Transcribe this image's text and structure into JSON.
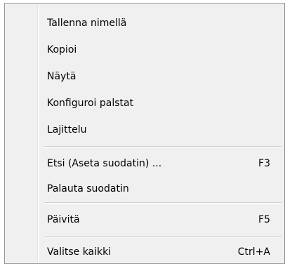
{
  "context_menu": {
    "items": [
      {
        "label": "Tallenna nimellä",
        "shortcut": ""
      },
      {
        "label": "Kopioi",
        "shortcut": ""
      },
      {
        "label": "Näytä",
        "shortcut": ""
      },
      {
        "label": "Konfiguroi palstat",
        "shortcut": ""
      },
      {
        "label": "Lajittelu",
        "shortcut": ""
      },
      {
        "label": "Etsi (Aseta suodatin) ...",
        "shortcut": "F3"
      },
      {
        "label": "Palauta suodatin",
        "shortcut": ""
      },
      {
        "label": "Päivitä",
        "shortcut": "F5"
      },
      {
        "label": "Valitse kaikki",
        "shortcut": "Ctrl+A"
      }
    ]
  }
}
